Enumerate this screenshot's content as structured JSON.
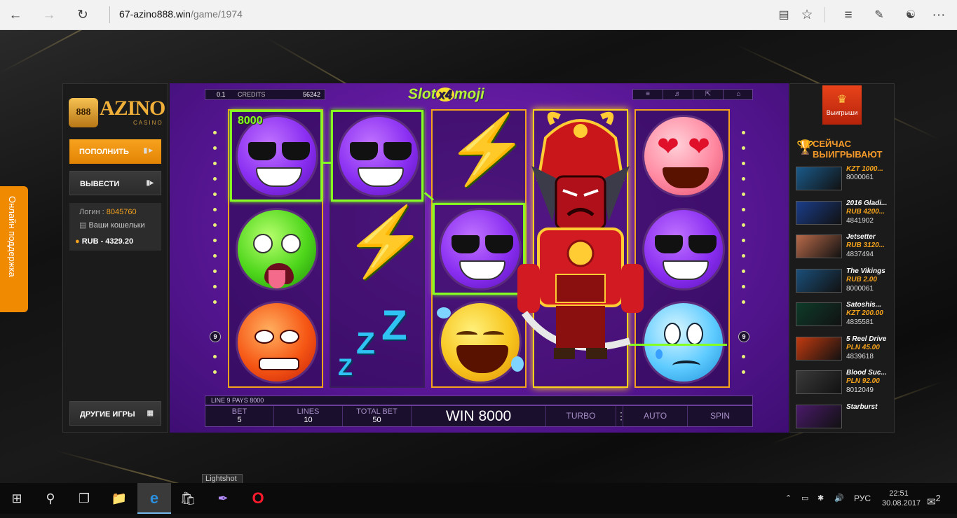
{
  "browser": {
    "url_domain": "67-azino888.win",
    "url_path": "/game/1974"
  },
  "site": {
    "logo_mark": "888",
    "logo_text": "AZINO",
    "logo_sub": "CASINO",
    "deposit_label": "ПОПОЛНИТЬ",
    "withdraw_label": "ВЫВЕСТИ",
    "login_label": "Логин :",
    "login_value": "8045760",
    "wallets_label": "Ваши кошельки",
    "balance": "RUB - 4329.20",
    "other_games": "ДРУГИЕ ИГРЫ",
    "support": "Онлайн поддержка"
  },
  "game": {
    "title_left": "Slot",
    "title_x4": "x4",
    "title_right": "moji",
    "bet_value": "0.1",
    "credits_label": "CREDITS",
    "credits_value": "56242",
    "win_amount_label": "8000",
    "line_badge_left": "9",
    "line_badge_right": "9",
    "message": "LINE 9 PAYS 8000",
    "controls": {
      "bet_label": "BET",
      "bet": "5",
      "lines_label": "LINES",
      "lines": "10",
      "total_label": "TOTAL BET",
      "total": "50",
      "win": "WIN 8000",
      "turbo": "TURBO",
      "auto": "AUTO",
      "spin": "SPIN"
    },
    "icons": [
      "menu-icon",
      "sound-icon",
      "fullscreen-icon",
      "home-icon"
    ]
  },
  "winners": {
    "badge": "Выигрыши",
    "heading_1": "СЕЙЧАС",
    "heading_2": "ВЫИГРЫВАЮТ",
    "items": [
      {
        "name": "KZT 1000...",
        "amount": "",
        "id": "8000061",
        "color": "#1a5a8a"
      },
      {
        "name": "2016 Gladi...",
        "amount": "RUB 4200...",
        "id": "4841902",
        "color": "#1a3d8a"
      },
      {
        "name": "Jetsetter",
        "amount": "RUB 3120...",
        "id": "4837494",
        "color": "#b86a4a"
      },
      {
        "name": "The Vikings",
        "amount": "RUB 2.00",
        "id": "8000061",
        "color": "#1a4f7a"
      },
      {
        "name": "Satoshis...",
        "amount": "KZT 200.00",
        "id": "4835581",
        "color": "#0e3b2a"
      },
      {
        "name": "5 Reel Drive",
        "amount": "PLN 45.00",
        "id": "4839618",
        "color": "#c23a10"
      },
      {
        "name": "Blood Suc...",
        "amount": "PLN 92.00",
        "id": "8012049",
        "color": "#3a3a3a"
      },
      {
        "name": "Starburst",
        "amount": "",
        "id": "",
        "color": "#4a1a6a"
      }
    ]
  },
  "taskbar": {
    "tooltip": "Lightshot",
    "lang": "РУС",
    "time": "22:51",
    "date": "30.08.2017",
    "notif": "2"
  }
}
